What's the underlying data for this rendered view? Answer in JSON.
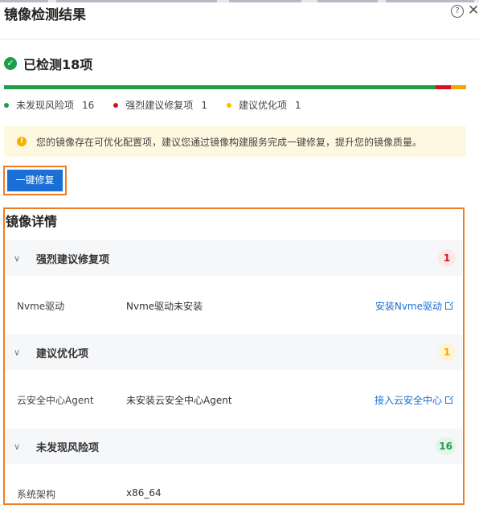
{
  "header": {
    "title": "镜像检测结果",
    "help_icon": "question-circle-icon",
    "close_icon": "close-icon"
  },
  "status": {
    "text": "已检测18项",
    "icon": "check-circle-icon"
  },
  "progress": {
    "pass": 16,
    "strong": 1,
    "suggest": 1,
    "colors": {
      "pass": "#1e9e4a",
      "strong": "#d6121e",
      "suggest": "#f5a700"
    }
  },
  "legend": [
    {
      "label": "未发现风险项",
      "count": "16",
      "color": "#1e9e4a"
    },
    {
      "label": "强烈建议修复项",
      "count": "1",
      "color": "#d6121e"
    },
    {
      "label": "建议优化项",
      "count": "1",
      "color": "#f5c400"
    }
  ],
  "alert": {
    "text": "您的镜像存在可优化配置项，建议您通过镜像构建服务完成一键修复，提升您的镜像质量。",
    "icon": "warning-icon"
  },
  "fix_button": {
    "label": "一键修复"
  },
  "details": {
    "title": "镜像详情",
    "sections": [
      {
        "title": "强烈建议修复项",
        "count": "1",
        "badge_bg": "#fde8e8",
        "badge_fg": "#d6121e",
        "row": {
          "key": "Nvme驱动",
          "value": "Nvme驱动未安装",
          "action": "安装Nvme驱动"
        }
      },
      {
        "title": "建议优化项",
        "count": "1",
        "badge_bg": "#fff3d6",
        "badge_fg": "#f5a700",
        "row": {
          "key": "云安全中心Agent",
          "value": "未安装云安全中心Agent",
          "action": "接入云安全中心"
        }
      },
      {
        "title": "未发现风险项",
        "count": "16",
        "badge_bg": "#e3f4e8",
        "badge_fg": "#1e9e4a",
        "row": {
          "key": "系统架构",
          "value": "x86_64",
          "action": ""
        }
      }
    ]
  }
}
